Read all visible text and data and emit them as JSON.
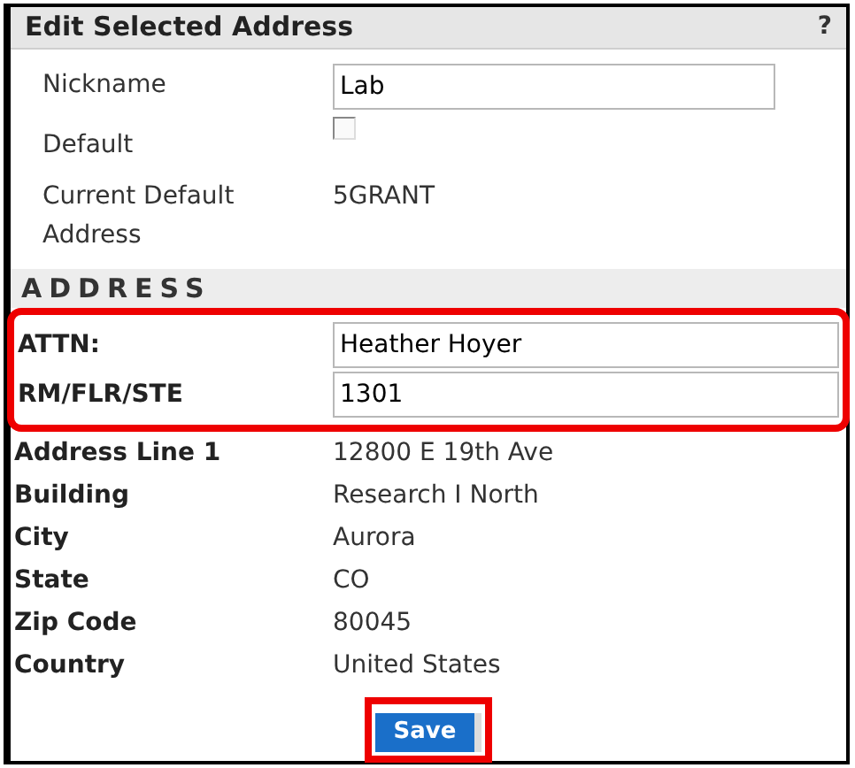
{
  "panel": {
    "title": "Edit Selected Address",
    "help": "?"
  },
  "general": {
    "nickname": {
      "label": "Nickname",
      "value": "Lab"
    },
    "default": {
      "label": "Default",
      "checked": false
    },
    "current_default": {
      "label": "Current Default Address",
      "value": "5GRANT"
    }
  },
  "address": {
    "heading": "ADDRESS",
    "highlighted": true,
    "fields": [
      {
        "label": "ATTN:",
        "value": "Heather Hoyer"
      },
      {
        "label": "RM/FLR/STE",
        "value": "1301"
      }
    ],
    "details": [
      {
        "label": "Address Line 1",
        "value": "12800 E 19th Ave"
      },
      {
        "label": "Building",
        "value": "Research I North"
      },
      {
        "label": "City",
        "value": "Aurora"
      },
      {
        "label": "State",
        "value": "CO"
      },
      {
        "label": "Zip Code",
        "value": "80045"
      },
      {
        "label": "Country",
        "value": "United States"
      }
    ]
  },
  "save_button": {
    "label": "Save",
    "highlighted": true
  }
}
